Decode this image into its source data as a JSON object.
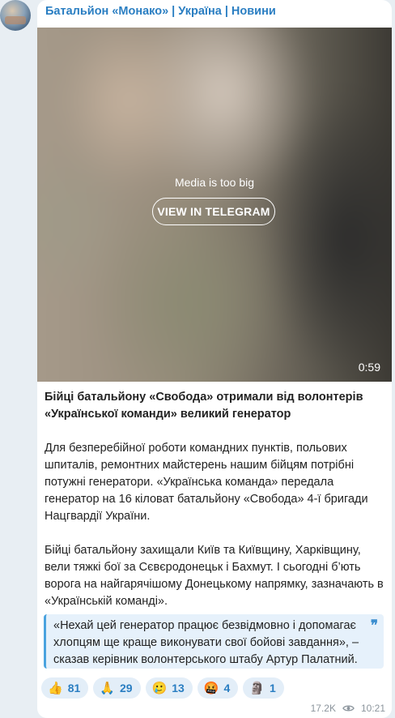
{
  "channel": {
    "name": "Батальйон «Монако» | Україна | Новини"
  },
  "media": {
    "message": "Media is too big",
    "button_label": "VIEW IN TELEGRAM",
    "duration": "0:59"
  },
  "post": {
    "title": "Бійці батальйону «Свобода» отримали від волонтерів «Української команди» великий генератор",
    "paragraph1": "Для безперебійної роботи командних пунктів, польових шпиталів, ремонтних майстерень нашим бійцям потрібні потужні генератори. «Українська команда» передала генератор на 16 кіловат батальйону «Свобода» 4-ї бригади Нацгвардії України.",
    "paragraph2": "Бійці батальйону захищали Київ та Київщину, Харківщину, вели тяжкі бої за Сєвєродонецьк і Бахмут. І сьогодні б’ють ворога на найгарячішому Донецькому напрямку, зазначають в «Українській команді».",
    "quote": "«Нехай цей генератор працює безвідмовно і допомагає хлопцям ще краще виконувати свої бойові завдання», – сказав керівник волонтерського штабу Артур Палатний.",
    "quote_mark": "❞"
  },
  "reactions": [
    {
      "emoji": "👍",
      "icon": "thumbs-up-icon",
      "count": "81"
    },
    {
      "emoji": "🙏",
      "icon": "folded-hands-icon",
      "count": "29"
    },
    {
      "emoji": "🥲",
      "icon": "smiling-tear-icon",
      "count": "13"
    },
    {
      "emoji": "🤬",
      "icon": "cursing-face-icon",
      "count": "4"
    },
    {
      "emoji": "🗿",
      "icon": "moai-icon",
      "count": "1"
    }
  ],
  "footer": {
    "views": "17.2K",
    "time": "10:21"
  },
  "colors": {
    "accent": "#2a7ec2",
    "background": "#e8eef3",
    "quote_bg": "#e6f1fb",
    "quote_border": "#4aa3df"
  }
}
